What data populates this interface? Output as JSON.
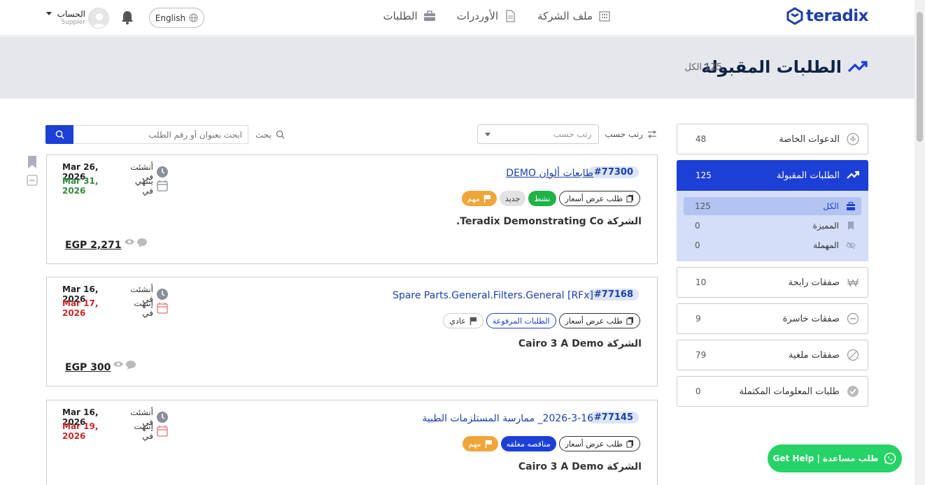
{
  "header": {
    "logo_text": "teradix",
    "nav": [
      {
        "label": "الطلبات",
        "icon": "briefcase-icon"
      },
      {
        "label": "الأوردرات",
        "icon": "document-icon"
      },
      {
        "label": "ملف الشركة",
        "icon": "building-icon"
      }
    ],
    "language": "English",
    "account_name": "الحساب",
    "account_role": "Suppier"
  },
  "hero": {
    "title": "الطلبات المقبولة",
    "count_text": "125 الكل"
  },
  "sidebar": {
    "items": [
      {
        "label": "الدعوات الخاصة",
        "count": "48",
        "icon": "inbox-icon"
      },
      {
        "label": "الطلبات المقبولة",
        "count": "125",
        "icon": "trend-up-icon",
        "active": true
      },
      {
        "label": "صفقات رابحة",
        "count": "10",
        "icon": "won-icon"
      },
      {
        "label": "صفقات خاسرة",
        "count": "9",
        "icon": "minus-circle-icon"
      },
      {
        "label": "صفقات ملغية",
        "count": "79",
        "icon": "cancel-circle-icon"
      },
      {
        "label": "طلبات المعلومات المكتملة",
        "count": "0",
        "icon": "check-circle-icon"
      }
    ],
    "sub_items": [
      {
        "label": "الكل",
        "count": "125",
        "icon": "briefcase-icon"
      },
      {
        "label": "المميزة",
        "count": "0",
        "icon": "bookmark-icon"
      },
      {
        "label": "المهملة",
        "count": "0",
        "icon": "eye-off-icon"
      }
    ]
  },
  "toolbar": {
    "sort_label": "رتب حسب",
    "sort_placeholder": "رتب حسب",
    "search_label": "بحث",
    "search_placeholder": "ابحث بعنوان أو رقم الطلب"
  },
  "cards": [
    {
      "id": "#77300",
      "title": "طابعات ألوان DEMO",
      "tags": [
        {
          "label": "طلب عرض أسعار",
          "style": "outline"
        },
        {
          "label": "نشط",
          "style": "green"
        },
        {
          "label": "جديد",
          "style": "grey"
        },
        {
          "label": "مهم",
          "style": "orange"
        }
      ],
      "company": "الشركة Teradix Demonstrating Co.",
      "created_label": "أنشئت في",
      "created_date": "Mar 26, 2026",
      "end_label": "ينتهي في",
      "end_date": "Mar 31, 2026",
      "end_color": "green",
      "price": "EGP 2,271"
    },
    {
      "id": "#77168",
      "title": "[RFx] Spare Parts.General.Filters.General",
      "tags": [
        {
          "label": "طلب عرض أسعار",
          "style": "outline"
        },
        {
          "label": "الطلبات المرفوعة",
          "style": "blueout"
        },
        {
          "label": "عادي",
          "style": "plain"
        }
      ],
      "company": "الشركة Cairo 3 A Demo",
      "created_label": "أنشئت في",
      "created_date": "Mar 16, 2026",
      "end_label": "إنتهت في",
      "end_date": "Mar 17, 2026",
      "end_color": "red",
      "price": "EGP 300"
    },
    {
      "id": "#77145",
      "title": "2026-3-16_ ممارسة المستلزمات الطبية",
      "tags": [
        {
          "label": "طلب عرض أسعار",
          "style": "outline"
        },
        {
          "label": "مناقصه مغلقه",
          "style": "blue"
        },
        {
          "label": "مهم",
          "style": "orange"
        }
      ],
      "company": "الشركة Cairo 3 A Demo",
      "created_label": "أنشئت في",
      "created_date": "Mar 16, 2026",
      "end_label": "إنتهت في",
      "end_date": "Mar 19, 2026",
      "end_color": "red",
      "price": ""
    }
  ],
  "help_button": "Get Help | طلب مساعدة",
  "colors": {
    "primary": "#1c3fd6",
    "hero_bg": "#e5e7ec",
    "sub_bg": "#d4def8",
    "whatsapp": "#25d366"
  }
}
